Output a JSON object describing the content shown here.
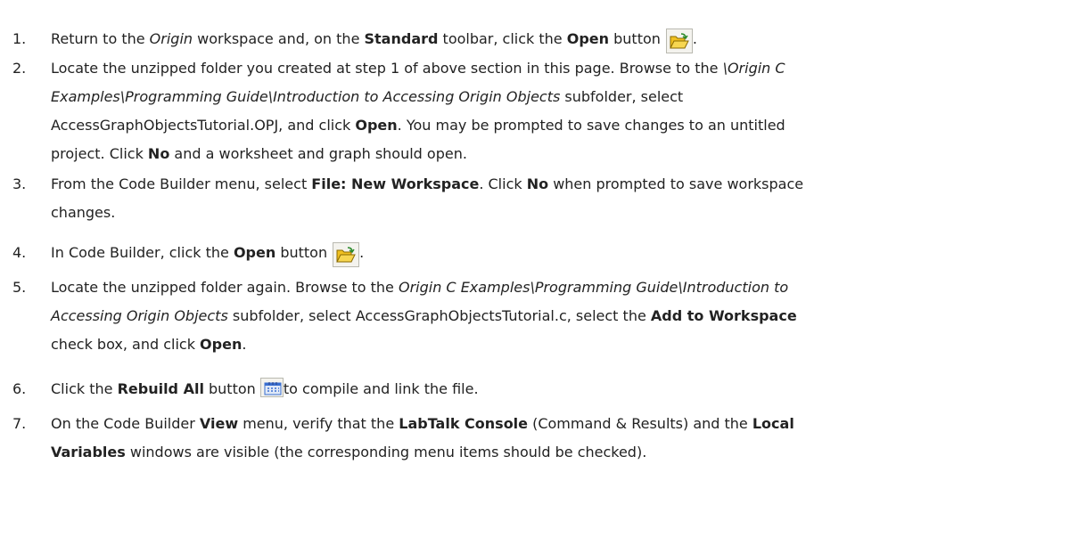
{
  "steps": [
    {
      "num": "1.",
      "t1": "Return to the ",
      "t2": "Origin",
      "t3": " workspace and, on the ",
      "t4": "Standard",
      "t5": " toolbar, click the ",
      "t6": "Open",
      "t7": " button",
      "t8": "."
    },
    {
      "num": "2.",
      "t1": "Locate the unzipped folder you created at step 1 of above section in this page. Browse to the ",
      "t2": "\\Origin C",
      "t3": "Examples\\Programming Guide\\Introduction to Accessing Origin Objects",
      "t4": " subfolder, select",
      "t5": "AccessGraphObjectsTutorial.OPJ, and click ",
      "t6": "Open",
      "t7": ". You may be prompted to save changes to an untitled",
      "t8": "project. Click ",
      "t9": "No",
      "t10": " and a worksheet and graph should open."
    },
    {
      "num": "3.",
      "t1": "From the Code Builder menu, select ",
      "t2": "File: New Workspace",
      "t3": ". Click ",
      "t4": "No",
      "t5": " when prompted to save workspace",
      "t6": "changes."
    },
    {
      "num": "4.",
      "t1": "In Code Builder, click the ",
      "t2": "Open",
      "t3": " button",
      "t4": "."
    },
    {
      "num": "5.",
      "t1": "Locate the unzipped folder again. Browse to the ",
      "t2": "Origin C Examples\\Programming Guide\\Introduction to",
      "t3": "Accessing Origin Objects",
      "t4": " subfolder, select AccessGraphObjectsTutorial.c, select the ",
      "t5": "Add to Workspace",
      "t6": "check box, and click ",
      "t7": "Open",
      "t8": "."
    },
    {
      "num": "6.",
      "t1": "Click the ",
      "t2": "Rebuild All",
      "t3": " button ",
      "t4": "to compile and link the file."
    },
    {
      "num": "7.",
      "t1": "On the Code Builder ",
      "t2": "View",
      "t3": " menu, verify that the ",
      "t4": "LabTalk Console",
      "t5": " (Command & Results) and the ",
      "t6": "Local",
      "t7": "Variables",
      "t8": " windows are visible (the corresponding menu items should be checked)."
    }
  ],
  "icons": {
    "open": "open-folder-icon",
    "rebuild": "rebuild-all-icon"
  },
  "colors": {
    "text": "#222222",
    "folder": "#f0c020",
    "folder_edge": "#8a6a00",
    "arrow": "#2a8a2a",
    "rebuild": "#3a6fd0"
  }
}
